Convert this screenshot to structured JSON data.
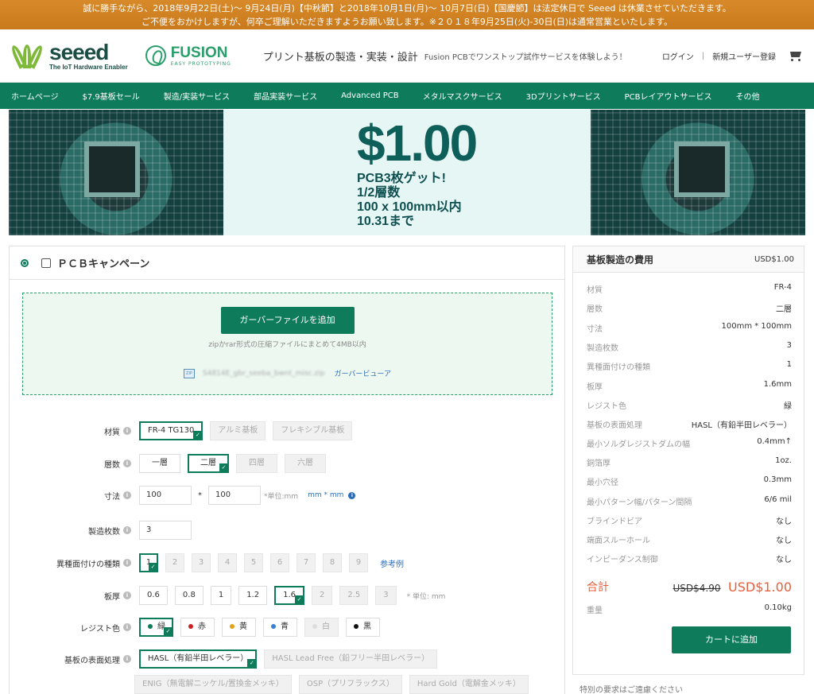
{
  "notice": {
    "line1": "誠に勝手ながら、2018年9月22日(土)～ 9月24日(月)【中秋節】と2018年10月1日(月)～ 10月7日(日)【国慶節】は法定休日で Seeed は休業させていただきます。",
    "line2": "ご不便をおかけしますが、何卒ご理解いただきますようお願い致します。※２０１８年9月25日(火)-30日(日)は通常営業といたします。"
  },
  "header": {
    "logo_word": "seeed",
    "logo_tag": "The IoT Hardware Enabler",
    "fusion_word": "FUSION",
    "fusion_tag": "EASY PROTOTYPING",
    "title": "プリント基板の製造・実装・設計",
    "subtitle": "Fusion PCBでワンストップ試作サービスを体験しよう！",
    "login": "ログイン",
    "separator": "|",
    "register": "新規ユーザー登録"
  },
  "nav": [
    "ホームページ",
    "$7.9基板セール",
    "製造/実装サービス",
    "部品実装サービス",
    "Advanced PCB",
    "メタルマスクサービス",
    "3Dプリントサービス",
    "PCBレイアウトサービス",
    "その他"
  ],
  "banner": {
    "price": "$1.00",
    "lines": [
      "PCB3枚ゲット!",
      "1/2層数",
      "100 x 100mm以内",
      "10.31まで"
    ]
  },
  "panel": {
    "title": "ＰＣＢキャンペーン",
    "upload_button": "ガーバーファイルを追加",
    "upload_hint": "zipかrar形式の圧縮ファイルにまとめて4MB以内",
    "zip_label": "ZIP",
    "file_name": "S4814E_gbr_seeba_bwnt_misc.zip",
    "viewer_link": "ガーバービューア"
  },
  "options": {
    "material": {
      "label": "材質",
      "items": [
        "FR-4 TG130",
        "アルミ基板",
        "フレキシブル基板"
      ]
    },
    "layers": {
      "label": "層数",
      "items": [
        "一層",
        "二層",
        "四層",
        "六層"
      ]
    },
    "size": {
      "label": "寸法",
      "w": "100",
      "x": "*",
      "h": "100",
      "unit": "*単位:mm",
      "unit_link": "mm * mm",
      "info": "i"
    },
    "quantity": {
      "label": "製造枚数",
      "value": "3"
    },
    "designs": {
      "label": "異種面付けの種類",
      "items": [
        "1",
        "2",
        "3",
        "4",
        "5",
        "6",
        "7",
        "8",
        "9"
      ],
      "ref": "参考例"
    },
    "thickness": {
      "label": "板厚",
      "items": [
        "0.6",
        "0.8",
        "1",
        "1.2",
        "1.6",
        "2",
        "2.5",
        "3"
      ],
      "unit": "* 単位: mm"
    },
    "color": {
      "label": "レジスト色",
      "items": [
        {
          "name": "緑",
          "dot": "#0e7c5b"
        },
        {
          "name": "赤",
          "dot": "#cc2222"
        },
        {
          "name": "黄",
          "dot": "#e6a019"
        },
        {
          "name": "青",
          "dot": "#3b7fd4"
        },
        {
          "name": "白",
          "dot": "#dddddd"
        },
        {
          "name": "黒",
          "dot": "#111111"
        }
      ]
    },
    "finish": {
      "label": "基板の表面処理",
      "items": [
        "HASL（有鉛半田レベラー）",
        "HASL Lead Free（鉛フリー半田レベラー）",
        "ENIG（無電解ニッケル/置換金メッキ）",
        "OSP（プリフラックス）",
        "Hard Gold（電解金メッキ）"
      ]
    }
  },
  "summary": {
    "title": "基板製造の費用",
    "price": "USD$1.00",
    "specs": [
      {
        "k": "材質",
        "v": "FR-4"
      },
      {
        "k": "層数",
        "v": "二層"
      },
      {
        "k": "寸法",
        "v": "100mm * 100mm"
      },
      {
        "k": "製造枚数",
        "v": "3"
      },
      {
        "k": "異種面付けの種類",
        "v": "1"
      },
      {
        "k": "板厚",
        "v": "1.6mm"
      },
      {
        "k": "レジスト色",
        "v": "緑"
      },
      {
        "k": "基板の表面処理",
        "v": "HASL（有鉛半田レベラー）"
      },
      {
        "k": "最小ソルダレジストダムの幅",
        "v": "0.4mm↑"
      },
      {
        "k": "銅箔厚",
        "v": "1oz."
      },
      {
        "k": "最小穴径",
        "v": "0.3mm"
      },
      {
        "k": "最小パターン幅/パターン間隔",
        "v": "6/6 mil"
      },
      {
        "k": "ブラインドビア",
        "v": "なし"
      },
      {
        "k": "端面スルーホール",
        "v": "なし"
      },
      {
        "k": "インピーダンス制御",
        "v": "なし"
      }
    ],
    "total_label": "合計",
    "old_price": "USD$4.90",
    "new_price": "USD$1.00",
    "weight_label": "重量",
    "weight": "0.10kg",
    "cart_button": "カートに追加",
    "special": "特別の要求はご遠慮ください"
  }
}
